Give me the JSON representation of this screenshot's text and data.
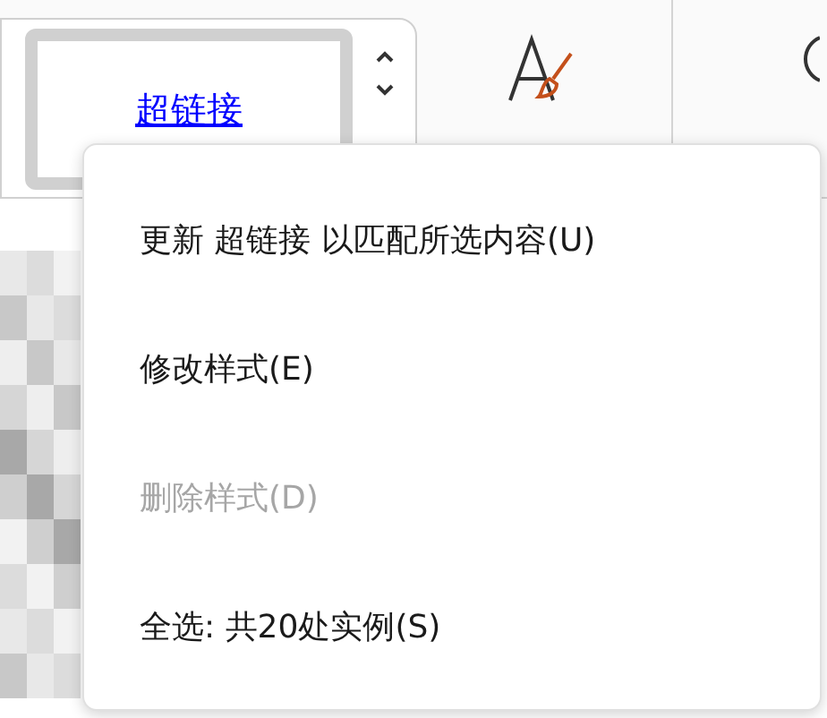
{
  "ribbon": {
    "style_gallery": {
      "items": [
        {
          "label": "超链接",
          "selected": true
        }
      ]
    }
  },
  "context_menu": {
    "items": [
      {
        "label": "更新 超链接 以匹配所选内容(U)",
        "disabled": false
      },
      {
        "label": "修改样式(E)",
        "disabled": false
      },
      {
        "label": "删除样式(D)",
        "disabled": true
      },
      {
        "label": "全选: 共20处实例(S)",
        "disabled": false
      }
    ]
  }
}
